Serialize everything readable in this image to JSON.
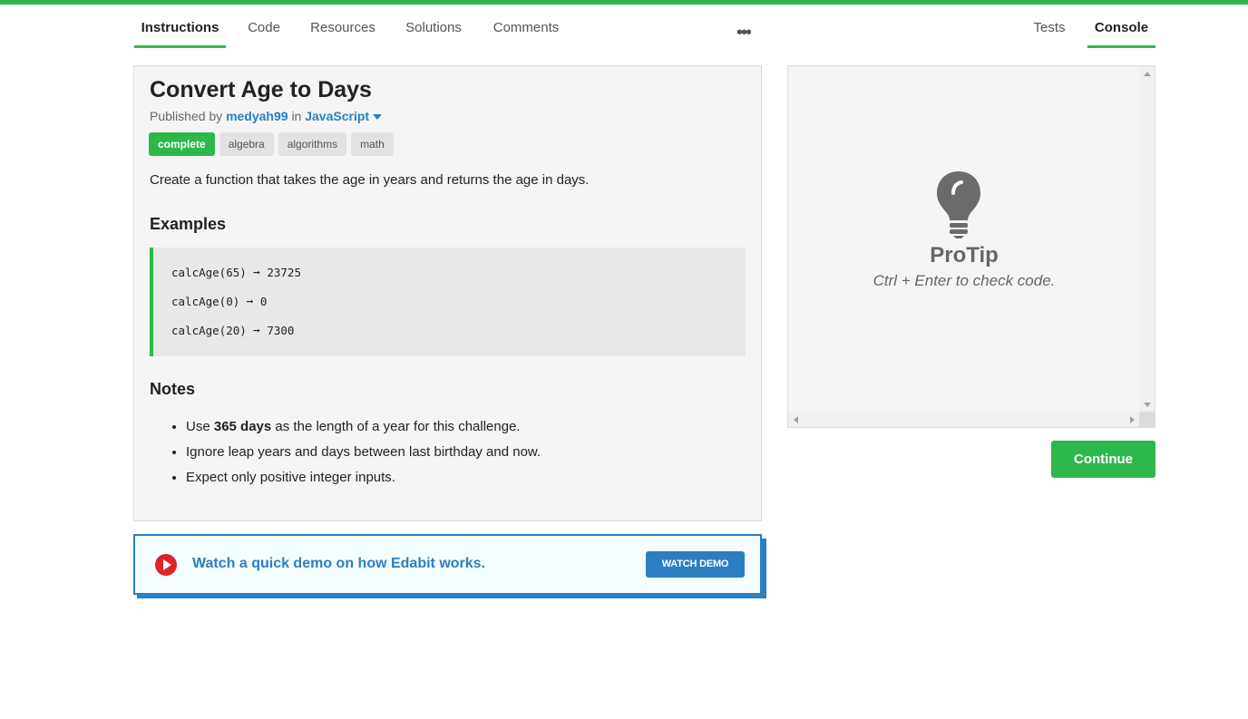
{
  "tabs_left": [
    {
      "label": "Instructions",
      "active": true
    },
    {
      "label": "Code",
      "active": false
    },
    {
      "label": "Resources",
      "active": false
    },
    {
      "label": "Solutions",
      "active": false
    },
    {
      "label": "Comments",
      "active": false
    }
  ],
  "more_glyph": "•••",
  "tabs_right": [
    {
      "label": "Tests",
      "active": false
    },
    {
      "label": "Console",
      "active": true
    }
  ],
  "challenge": {
    "title": "Convert Age to Days",
    "published_by_prefix": "Published by",
    "author": "medyah99",
    "in_word": "in",
    "language": "JavaScript",
    "tags": [
      "complete",
      "algebra",
      "algorithms",
      "math"
    ],
    "description": "Create a function that takes the age in years and returns the age in days.",
    "examples_heading": "Examples",
    "examples": [
      "calcAge(65) ➞ 23725",
      "calcAge(0) ➞ 0",
      "calcAge(20) ➞ 7300"
    ],
    "notes_heading": "Notes",
    "notes": {
      "note1_prefix": "Use",
      "note1_bold": "365 days",
      "note1_suffix": "as the length of a year for this challenge.",
      "note2": "Ignore leap years and days between last birthday and now.",
      "note3": "Expect only positive integer inputs."
    }
  },
  "demo": {
    "text": "Watch a quick demo on how Edabit works.",
    "button": "WATCH DEMO"
  },
  "console": {
    "protip_title": "ProTip",
    "protip_text": "Ctrl + Enter to check code."
  },
  "continue_button": "Continue",
  "colors": {
    "accent_green": "#2eb84b",
    "link_blue": "#2b7fc2",
    "play_red": "#d9262b"
  }
}
